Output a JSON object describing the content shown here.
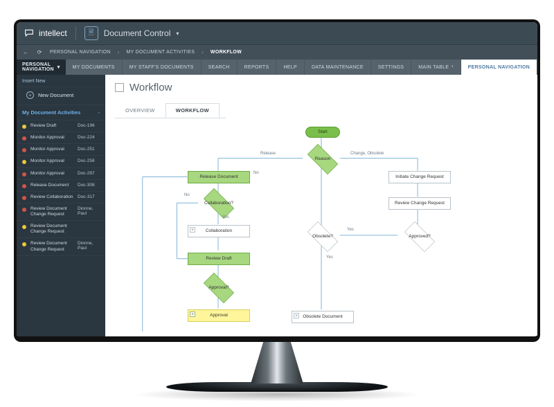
{
  "brand": {
    "name": "intellect"
  },
  "header": {
    "title": "Document Control"
  },
  "breadcrumb": {
    "items": [
      "PERSONAL NAVIGATION",
      "MY DOCUMENT ACTIVITIES",
      "WORKFLOW"
    ]
  },
  "leftpane_title": "PERSONAL NAVIGATION",
  "tabs": [
    "MY DOCUMENTS",
    "MY STAFF'S DOCUMENTS",
    "SEARCH",
    "REPORTS",
    "HELP",
    "DATA MAINTENANCE",
    "SETTINGS",
    "MAIN TABLE",
    "PERSONAL NAVIGATION"
  ],
  "tabs_active_index": 8,
  "sidebar": {
    "insert_label": "Insert New",
    "new_doc_label": "New Document",
    "section_label": "My Document Activities",
    "dot_colors": {
      "yellow": "#e7c93a",
      "red": "#d4534a"
    },
    "items": [
      {
        "dot": "yellow",
        "label": "Review Draft",
        "value": "Doc-196"
      },
      {
        "dot": "red",
        "label": "Monitor Approval",
        "value": "Doc-224"
      },
      {
        "dot": "red",
        "label": "Monitor Approval",
        "value": "Doc-251"
      },
      {
        "dot": "yellow",
        "label": "Monitor Approval",
        "value": "Doc-258"
      },
      {
        "dot": "red",
        "label": "Monitor Approval",
        "value": "Doc-297"
      },
      {
        "dot": "red",
        "label": "Release Document",
        "value": "Doc-308"
      },
      {
        "dot": "red",
        "label": "Review Collaboration",
        "value": "Doc-317"
      },
      {
        "dot": "red",
        "label": "Review Document Change Request",
        "value": "Dionne, Paul"
      },
      {
        "dot": "yellow",
        "label": "Review Document Change Request",
        "value": ""
      },
      {
        "dot": "yellow",
        "label": "Review Document Change Request",
        "value": "Dionne, Paul"
      }
    ]
  },
  "page": {
    "title": "Workflow",
    "subtabs": [
      "OVERVIEW",
      "WORKFLOW"
    ],
    "subtab_active_index": 1
  },
  "flow": {
    "start": "Start",
    "reason": "Reason",
    "release_document": "Release Document",
    "collaboration_q": "Collaboration?",
    "collaboration": "Collaboration",
    "review_draft": "Review Draft",
    "approval_q": "Approval?",
    "approval": "Approval",
    "obsolete_q": "Obsolete?",
    "obsolete_doc": "Obsolete Document",
    "approved_q": "Approved?",
    "init_change": "Initiate Change Request",
    "review_change": "Review Change Request",
    "labels": {
      "release": "Release",
      "change": "Change, Obsolete",
      "no": "No",
      "yes": "Yes"
    }
  }
}
